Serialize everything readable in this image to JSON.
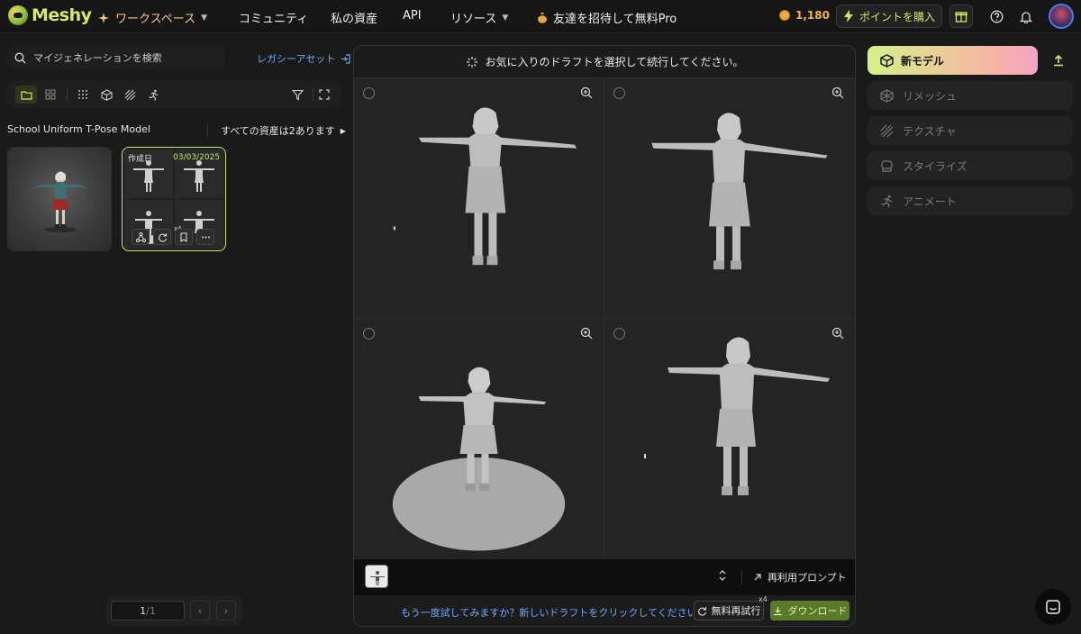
{
  "app": {
    "name": "Meshy"
  },
  "topnav": {
    "workspace": "ワークスペース",
    "community": "コミュニティ",
    "assets": "私の資産",
    "api": "API",
    "resources": "リソース",
    "invite": "友達を招待して無料Pro",
    "credits": "1,180",
    "buy_points": "ポイントを購入"
  },
  "left": {
    "search_placeholder": "マイジェネレーションを検索",
    "legacy_assets": "レガシーアセット",
    "model_title": "School Uniform T-Pose Model",
    "asset_count": "すべての資産は2あります",
    "card2": {
      "created_label": "作成日",
      "date": "03/03/2025",
      "multiplier": "x4"
    },
    "pager": {
      "current": "1",
      "total": "/1"
    }
  },
  "center": {
    "header": "お気に入りのドラフトを選択して続行してください。",
    "reuse_prompt": "再利用プロンプト",
    "retry_hint": "もう一度試してみますか？新しいドラフトをクリックしてください。",
    "retry_arrow": "→",
    "free_retry": "無料再試行",
    "retry_multiplier": "x4",
    "download": "ダウンロード"
  },
  "right": {
    "new_model": "新モデル",
    "items": [
      "リメッシュ",
      "テクスチャ",
      "スタイライズ",
      "アニメート"
    ]
  },
  "colors": {
    "accent": "#c9e35c",
    "link": "#6fa6ff",
    "credits": "#f0b24a"
  }
}
